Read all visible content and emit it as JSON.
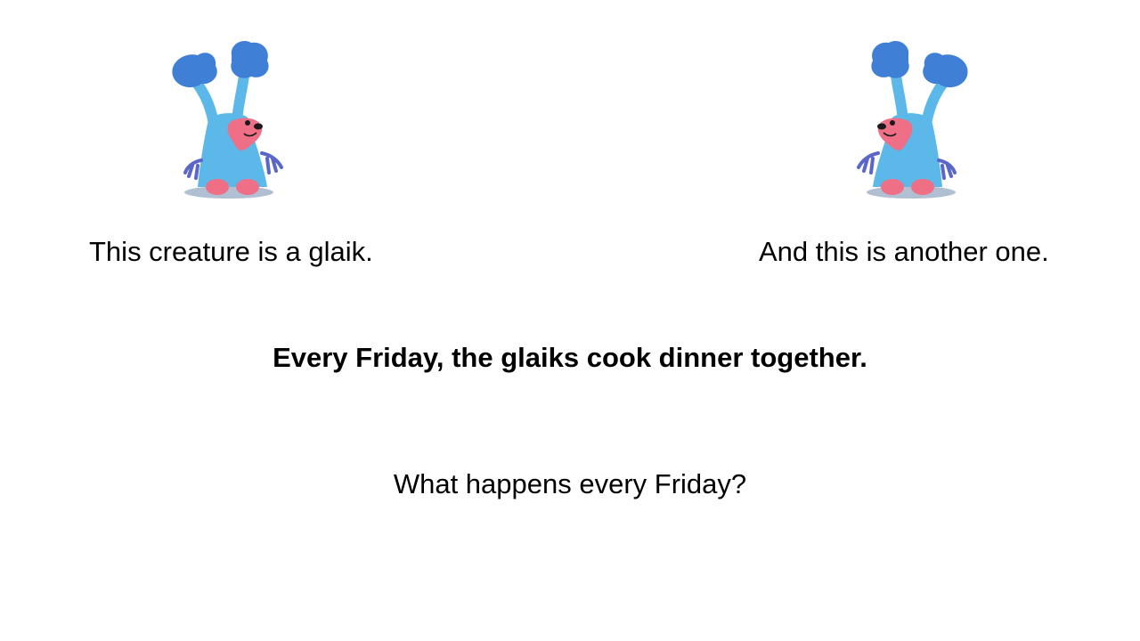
{
  "slide": {
    "caption_left": "This creature is a glaik.",
    "caption_right": "And this is another one.",
    "statement": "Every Friday, the glaiks cook dinner together.",
    "question": "What happens every Friday?"
  },
  "illustrations": [
    {
      "icon": "glaik-creature-icon",
      "facing": "right"
    },
    {
      "icon": "glaik-creature-icon",
      "facing": "left"
    }
  ],
  "colors": {
    "background": "#ffffff",
    "text": "#000000",
    "creature_body": "#5bb8e8",
    "creature_head": "#3f7fd6",
    "creature_face": "#ef6f86",
    "creature_hands": "#5b66c9",
    "shadow": "#8ea4bd"
  }
}
